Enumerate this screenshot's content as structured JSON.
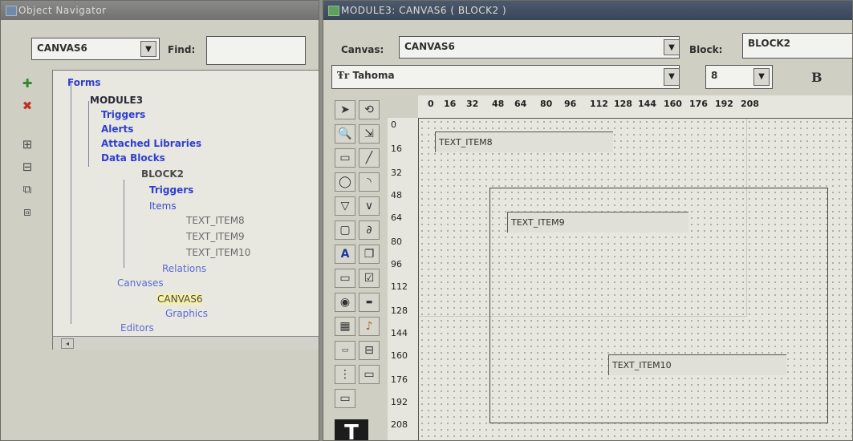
{
  "navigator": {
    "title": "Object Navigator",
    "selector_value": "CANVAS6",
    "find_label": "Find:",
    "find_value": "",
    "side_buttons": [
      "plus-icon",
      "delete-icon",
      "expand-icon",
      "collapse-icon",
      "expand-all-icon",
      "collapse-all-icon"
    ],
    "tree": {
      "forms": "Forms",
      "module": "MODULE3",
      "triggers": "Triggers",
      "alerts": "Alerts",
      "attached_libraries": "Attached Libraries",
      "data_blocks": "Data Blocks",
      "block": "BLOCK2",
      "block_triggers": "Triggers",
      "items": "Items",
      "item1": "TEXT_ITEM8",
      "item2": "TEXT_ITEM9",
      "item3": "TEXT_ITEM10",
      "relations": "Relations",
      "canvases": "Canvases",
      "canvas": "CANVAS6",
      "graphics": "Graphics",
      "editors": "Editors"
    }
  },
  "layout_editor": {
    "title": "MODULE3: CANVAS6 ( BLOCK2 )",
    "canvas_label": "Canvas:",
    "canvas_value": "CANVAS6",
    "block_label": "Block:",
    "block_value": "BLOCK2",
    "font_value": "Tahoma",
    "font_size": "8",
    "bold_label": "B",
    "ruler_x": [
      "0",
      "16",
      "32",
      "48",
      "64",
      "80",
      "96",
      "112",
      "128",
      "144",
      "160",
      "176",
      "192",
      "208"
    ],
    "ruler_y": [
      "0",
      "16",
      "32",
      "48",
      "64",
      "80",
      "96",
      "112",
      "128",
      "144",
      "160",
      "176",
      "192",
      "208"
    ],
    "items": [
      "TEXT_ITEM8",
      "TEXT_ITEM9",
      "TEXT_ITEM10"
    ]
  }
}
